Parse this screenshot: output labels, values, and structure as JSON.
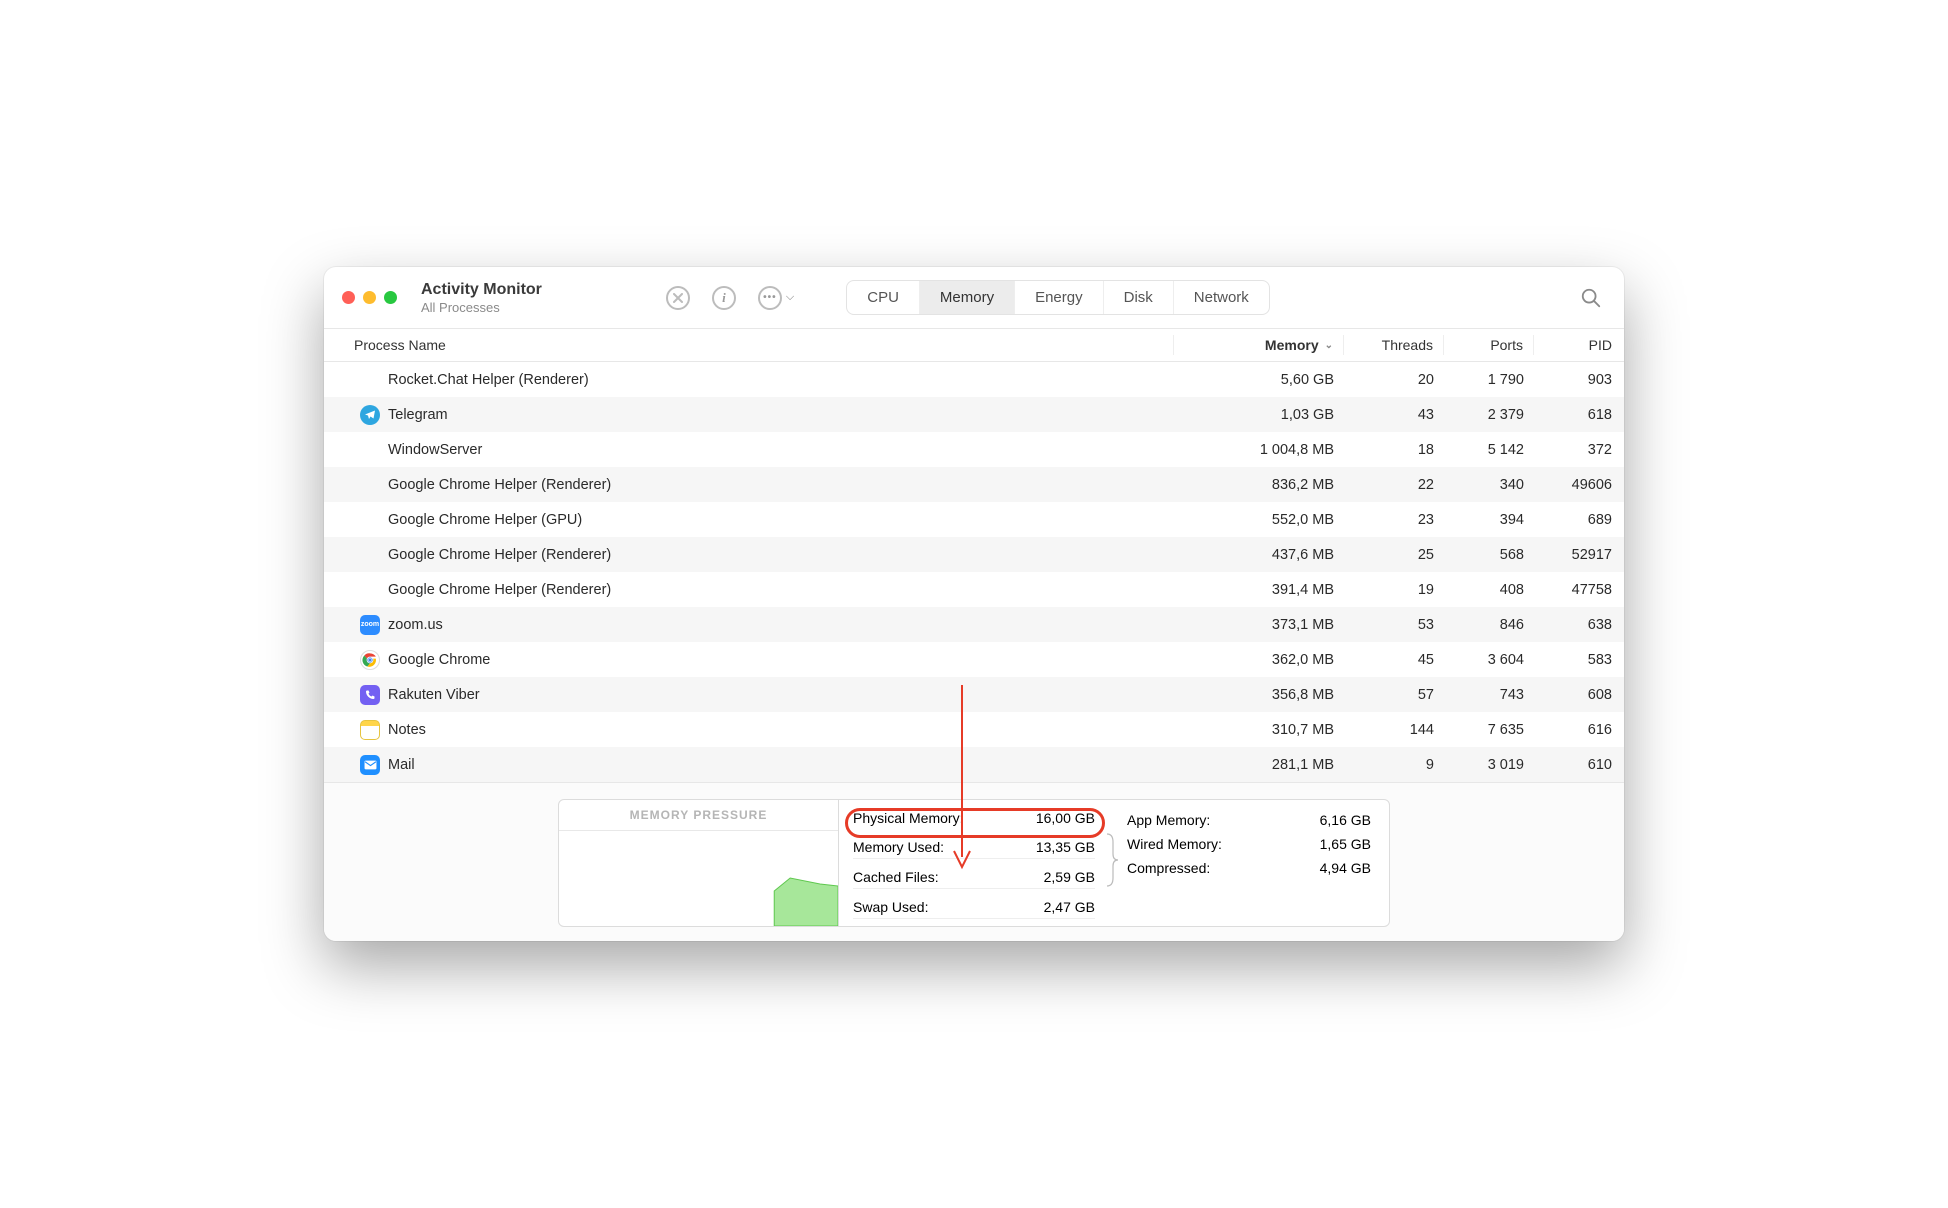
{
  "window": {
    "title": "Activity Monitor",
    "subtitle": "All Processes"
  },
  "tabs": {
    "cpu": "CPU",
    "memory": "Memory",
    "energy": "Energy",
    "disk": "Disk",
    "network": "Network"
  },
  "columns": {
    "name": "Process Name",
    "memory": "Memory",
    "threads": "Threads",
    "ports": "Ports",
    "pid": "PID"
  },
  "rows": [
    {
      "name": "Rocket.Chat Helper (Renderer)",
      "memory": "5,60 GB",
      "threads": "20",
      "ports": "1 790",
      "pid": "903",
      "icon": ""
    },
    {
      "name": "Telegram",
      "memory": "1,03 GB",
      "threads": "43",
      "ports": "2 379",
      "pid": "618",
      "icon": "telegram"
    },
    {
      "name": "WindowServer",
      "memory": "1 004,8 MB",
      "threads": "18",
      "ports": "5 142",
      "pid": "372",
      "icon": ""
    },
    {
      "name": "Google Chrome Helper (Renderer)",
      "memory": "836,2 MB",
      "threads": "22",
      "ports": "340",
      "pid": "49606",
      "icon": ""
    },
    {
      "name": "Google Chrome Helper (GPU)",
      "memory": "552,0 MB",
      "threads": "23",
      "ports": "394",
      "pid": "689",
      "icon": ""
    },
    {
      "name": "Google Chrome Helper (Renderer)",
      "memory": "437,6 MB",
      "threads": "25",
      "ports": "568",
      "pid": "52917",
      "icon": ""
    },
    {
      "name": "Google Chrome Helper (Renderer)",
      "memory": "391,4 MB",
      "threads": "19",
      "ports": "408",
      "pid": "47758",
      "icon": ""
    },
    {
      "name": "zoom.us",
      "memory": "373,1 MB",
      "threads": "53",
      "ports": "846",
      "pid": "638",
      "icon": "zoom"
    },
    {
      "name": "Google Chrome",
      "memory": "362,0 MB",
      "threads": "45",
      "ports": "3 604",
      "pid": "583",
      "icon": "chrome"
    },
    {
      "name": "Rakuten Viber",
      "memory": "356,8 MB",
      "threads": "57",
      "ports": "743",
      "pid": "608",
      "icon": "viber"
    },
    {
      "name": "Notes",
      "memory": "310,7 MB",
      "threads": "144",
      "ports": "7 635",
      "pid": "616",
      "icon": "notes"
    },
    {
      "name": "Mail",
      "memory": "281,1 MB",
      "threads": "9",
      "ports": "3 019",
      "pid": "610",
      "icon": "mail"
    }
  ],
  "footer": {
    "pressure_title": "MEMORY PRESSURE",
    "physical_memory_label": "Physical Memory:",
    "physical_memory_value": "16,00 GB",
    "memory_used_label": "Memory Used:",
    "memory_used_value": "13,35 GB",
    "cached_files_label": "Cached Files:",
    "cached_files_value": "2,59 GB",
    "swap_used_label": "Swap Used:",
    "swap_used_value": "2,47 GB",
    "app_memory_label": "App Memory:",
    "app_memory_value": "6,16 GB",
    "wired_memory_label": "Wired Memory:",
    "wired_memory_value": "1,65 GB",
    "compressed_label": "Compressed:",
    "compressed_value": "4,94 GB"
  }
}
